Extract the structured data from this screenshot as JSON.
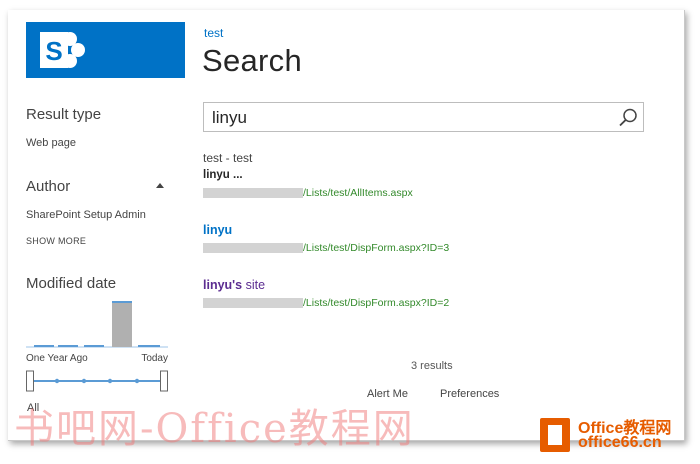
{
  "header": {
    "site_link": "test",
    "page_title": "Search"
  },
  "search": {
    "value": "linyu",
    "icon": "search-icon"
  },
  "refiners": {
    "result_type": {
      "heading": "Result type",
      "item": "Web page"
    },
    "author": {
      "heading": "Author",
      "item": "SharePoint Setup Admin",
      "show_more": "SHOW MORE"
    },
    "modified_date": {
      "heading": "Modified date",
      "from_label": "One Year Ago",
      "to_label": "Today",
      "all_label": "All"
    }
  },
  "results": [
    {
      "title": "test - test",
      "subtitle": "linyu ...",
      "url": "/Lists/test/AllItems.aspx"
    },
    {
      "title": "linyu",
      "url": "/Lists/test/DispForm.aspx?ID=3"
    },
    {
      "title_bold": "linyu's",
      "title_rest": " site",
      "url": "/Lists/test/DispForm.aspx?ID=2"
    }
  ],
  "results_count": "3 results",
  "footer": {
    "alert_me": "Alert Me",
    "preferences": "Preferences"
  },
  "watermark": {
    "text": "书吧网-Office教程网",
    "badge_name": "Office教程网",
    "badge_url": "office66.cn"
  },
  "colors": {
    "brand": "#0072c6",
    "url_green": "#338a2b",
    "visited": "#5c2d91"
  }
}
